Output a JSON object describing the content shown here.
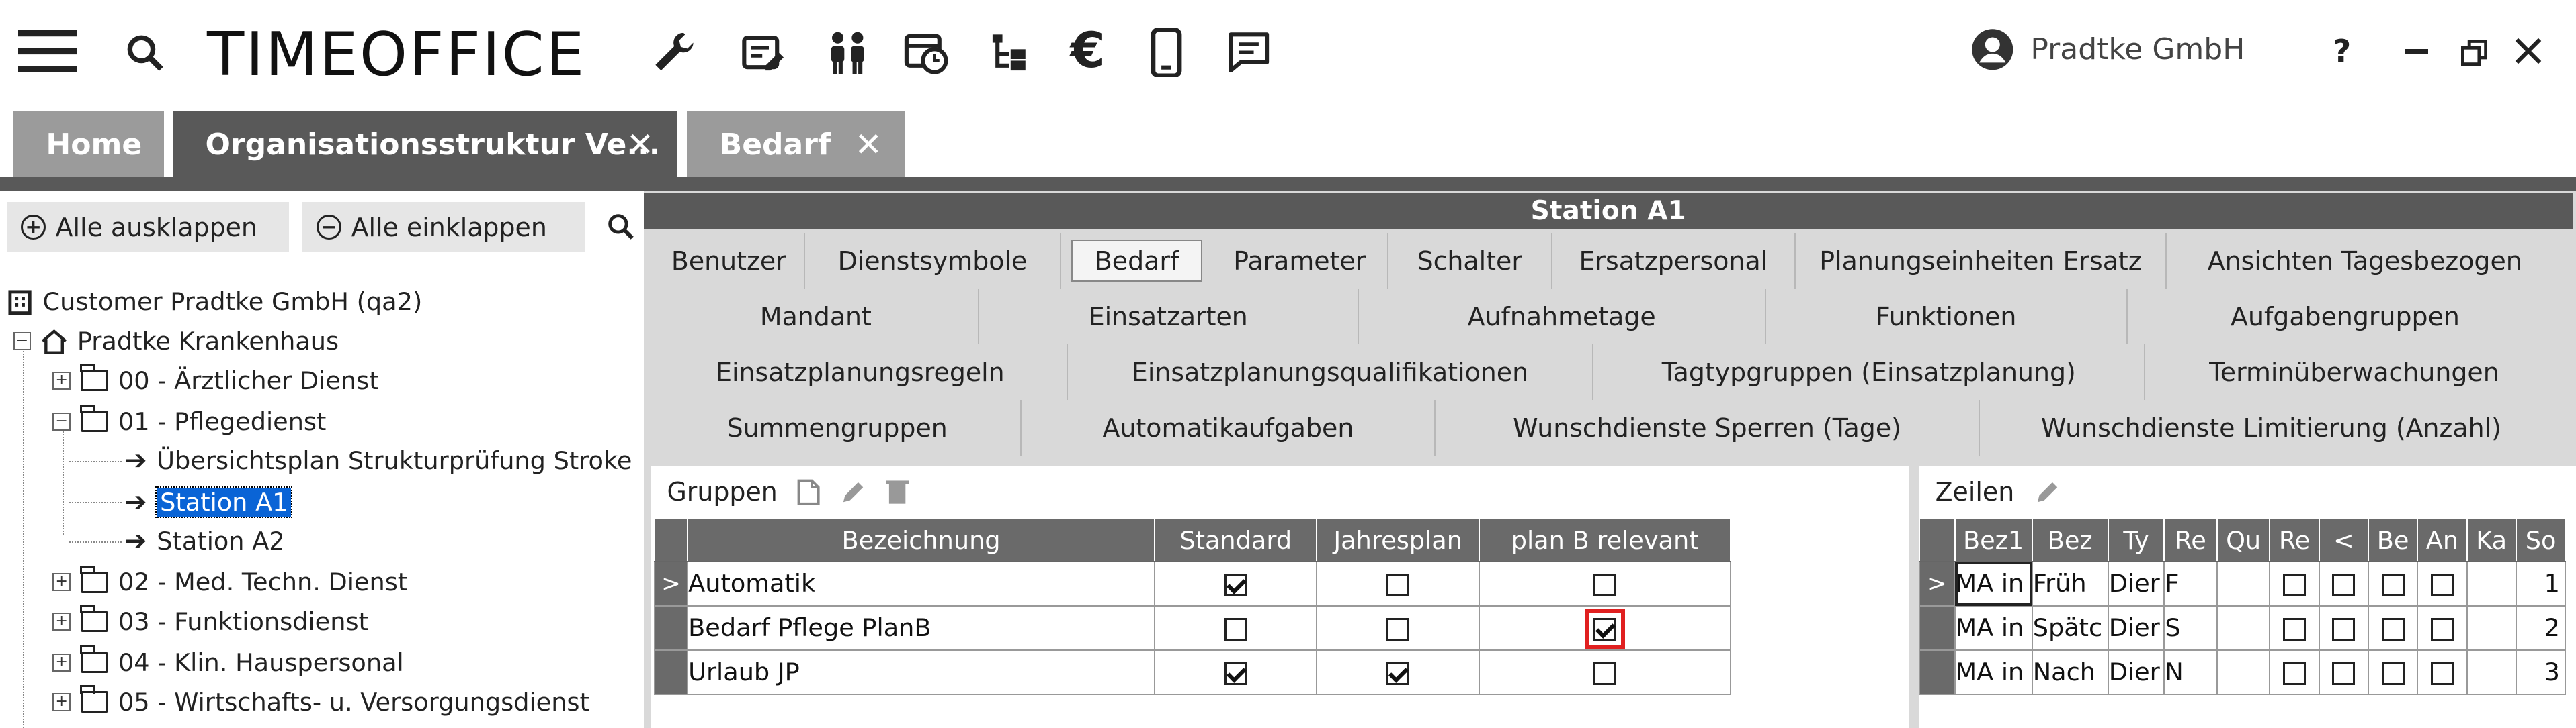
{
  "app": {
    "logo": "TIMEOFFICE",
    "user": "Pradtke GmbH",
    "help": "?",
    "minimize": "—",
    "restore": "⧉",
    "close": "✕"
  },
  "toolbar_icons": [
    "menu-icon",
    "search-icon",
    "wrench-icon",
    "form-edit-icon",
    "people-icon",
    "calendar-clock-icon",
    "hierarchy-icon",
    "euro-icon",
    "mobile-icon",
    "message-icon"
  ],
  "tabs": [
    {
      "label": "Home"
    },
    {
      "label": "Organisationsstruktur Ve...",
      "close": "✕"
    },
    {
      "label": "Bedarf",
      "close": "✕"
    }
  ],
  "left": {
    "expand_all": "Alle ausklappen",
    "collapse_all": "Alle einklappen",
    "tree": [
      {
        "label": "Customer Pradtke GmbH (qa2)"
      },
      {
        "label": "Pradtke Krankenhaus"
      },
      {
        "label": "00 - Ärztlicher Dienst"
      },
      {
        "label": "01 - Pflegedienst"
      },
      {
        "label": "Übersichtsplan Strukturprüfung Stroke"
      },
      {
        "label": "Station A1"
      },
      {
        "label": "Station A2"
      },
      {
        "label": "02 - Med. Techn. Dienst"
      },
      {
        "label": "03 - Funktionsdienst"
      },
      {
        "label": "04 - Klin. Hauspersonal"
      },
      {
        "label": "05 - Wirtschafts- u. Versorgungsdienst"
      }
    ]
  },
  "right": {
    "header": "Station A1",
    "tab_rows": [
      [
        "Benutzer",
        "Dienstsymbole",
        "Bedarf",
        "Parameter",
        "Schalter",
        "Ersatzpersonal",
        "Planungseinheiten Ersatz",
        "Ansichten Tagesbezogen"
      ],
      [
        "Mandant",
        "Einsatzarten",
        "Aufnahmetage",
        "Funktionen",
        "Aufgabengruppen"
      ],
      [
        "Einsatzplanungsregeln",
        "Einsatzplanungsqualifikationen",
        "Tagtypgruppen (Einsatzplanung)",
        "Terminüberwachungen"
      ],
      [
        "Summengruppen",
        "Automatikaufgaben",
        "Wunschdienste Sperren (Tage)",
        "Wunschdienste Limitierung (Anzahl)"
      ]
    ],
    "active_tab": "Bedarf",
    "gruppen": {
      "title": "Gruppen",
      "columns": [
        "Bezeichnung",
        "Standard",
        "Jahresplan",
        "plan B relevant"
      ],
      "rows": [
        {
          "marker": ">",
          "name": "Automatik",
          "standard": true,
          "jahresplan": false,
          "planb": false
        },
        {
          "marker": "",
          "name": "Bedarf Pflege PlanB",
          "standard": false,
          "jahresplan": false,
          "planb": true
        },
        {
          "marker": "",
          "name": "Urlaub JP",
          "standard": true,
          "jahresplan": true,
          "planb": false
        }
      ]
    },
    "zeilen": {
      "title": "Zeilen",
      "columns": [
        "Bez1",
        "Bez",
        "Ty",
        "Re",
        "Qu",
        "Re",
        "<",
        "Be",
        "An",
        "Ka",
        "So"
      ],
      "rows": [
        {
          "marker": ">",
          "bez1": "MA in",
          "bez": "Früh",
          "ty": "Dier",
          "re": "F",
          "so": "1"
        },
        {
          "marker": "",
          "bez1": "MA in",
          "bez": "Spätc",
          "ty": "Dier",
          "re": "S",
          "so": "2"
        },
        {
          "marker": "",
          "bez1": "MA in",
          "bez": "Nach",
          "ty": "Dier",
          "re": "N",
          "so": "3"
        }
      ]
    }
  }
}
